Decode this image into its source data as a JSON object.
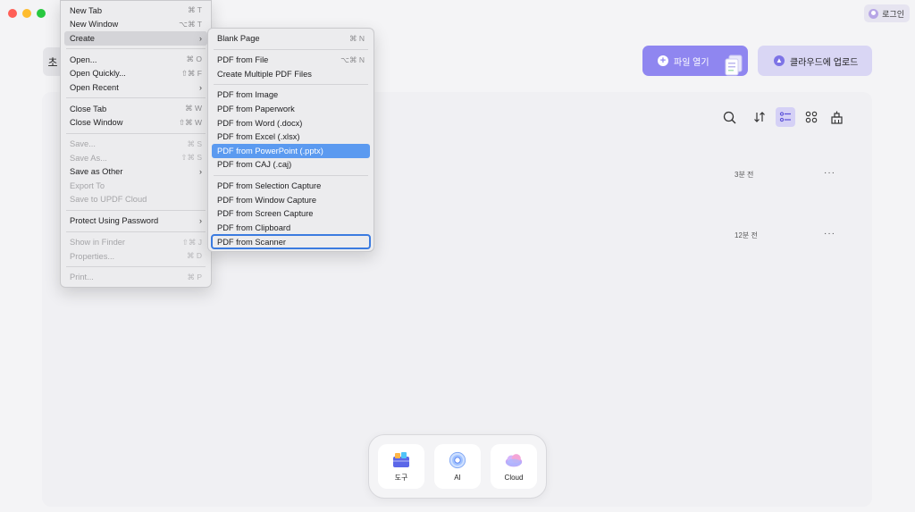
{
  "header": {
    "login_label": "로그인",
    "left_tab_label": "초"
  },
  "actions": {
    "open_file_label": "파일 열기",
    "upload_cloud_label": "클라우드에 업로드"
  },
  "toolbar": {
    "icons": [
      "search-icon",
      "sort-icon",
      "list-view-icon",
      "grid-view-icon",
      "clean-icon"
    ],
    "active": "list-view-icon"
  },
  "files": [
    {
      "time": "3분 전",
      "more": "···"
    },
    {
      "time": "12분 전",
      "more": "···"
    }
  ],
  "file_menu": {
    "items": [
      {
        "label": "New Tab",
        "shortcut": "⌘ T"
      },
      {
        "label": "New Window",
        "shortcut": "⌥⌘ T"
      },
      {
        "label": "Create",
        "submenu": true,
        "highlighted": true
      },
      {
        "sep": true
      },
      {
        "label": "Open...",
        "shortcut": "⌘ O"
      },
      {
        "label": "Open Quickly...",
        "shortcut": "⇧⌘ F"
      },
      {
        "label": "Open Recent",
        "submenu": true
      },
      {
        "sep": true
      },
      {
        "label": "Close Tab",
        "shortcut": "⌘ W"
      },
      {
        "label": "Close Window",
        "shortcut": "⇧⌘ W"
      },
      {
        "sep": true
      },
      {
        "label": "Save...",
        "shortcut": "⌘ S",
        "disabled": true
      },
      {
        "label": "Save As...",
        "shortcut": "⇧⌘ S",
        "disabled": true
      },
      {
        "label": "Save as Other",
        "submenu": true
      },
      {
        "label": "Export To",
        "disabled": true
      },
      {
        "label": "Save to UPDF Cloud",
        "disabled": true
      },
      {
        "sep": true
      },
      {
        "label": "Protect Using Password",
        "submenu": true
      },
      {
        "sep": true
      },
      {
        "label": "Show in Finder",
        "shortcut": "⇧⌘ J",
        "disabled": true
      },
      {
        "label": "Properties...",
        "shortcut": "⌘ D",
        "disabled": true
      },
      {
        "sep": true
      },
      {
        "label": "Print...",
        "shortcut": "⌘ P",
        "disabled": true
      }
    ]
  },
  "create_menu": {
    "items": [
      {
        "label": "Blank Page",
        "shortcut": "⌘ N"
      },
      {
        "sep": true
      },
      {
        "label": "PDF from File",
        "shortcut": "⌥⌘ N"
      },
      {
        "label": "Create Multiple PDF Files"
      },
      {
        "sep": true
      },
      {
        "label": "PDF from Image"
      },
      {
        "label": "PDF from Paperwork"
      },
      {
        "label": "PDF from Word (.docx)"
      },
      {
        "label": "PDF from Excel (.xlsx)"
      },
      {
        "label": "PDF from PowerPoint (.pptx)",
        "selected": true
      },
      {
        "label": "PDF from CAJ (.caj)"
      },
      {
        "sep": true
      },
      {
        "label": "PDF from Selection Capture"
      },
      {
        "label": "PDF from Window Capture"
      },
      {
        "label": "PDF from Screen Capture"
      },
      {
        "label": "PDF from Clipboard"
      },
      {
        "label": "PDF from Scanner",
        "boxed": true
      }
    ]
  },
  "dock": {
    "items": [
      {
        "label": "도구",
        "icon": "tools-icon"
      },
      {
        "label": "AI",
        "icon": "ai-icon"
      },
      {
        "label": "Cloud",
        "icon": "cloud-icon"
      }
    ]
  },
  "colors": {
    "accent": "#8f86f0",
    "accent_light": "#d9d6f4",
    "menu_selected": "#5b9af0",
    "focus_outline": "#3b7be0"
  }
}
